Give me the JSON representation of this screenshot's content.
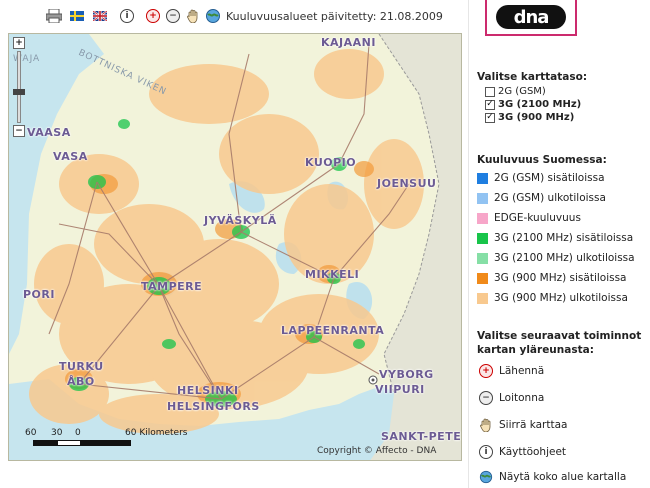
{
  "toolbar": {
    "updated_text": "Kuuluvuusalueet päivitetty: 21.08.2009",
    "icons": [
      "print-icon",
      "swedish-flag-icon",
      "uk-flag-icon",
      "info-icon",
      "zoom-in-icon",
      "zoom-out-icon",
      "pan-hand-icon",
      "full-extent-icon"
    ]
  },
  "map": {
    "cities": [
      "KAJAANI",
      "VAASA",
      "KUOPIO",
      "JOENSUU",
      "JYVÄSKYLÄ",
      "MIKKELI",
      "TAMPERE",
      "LAPPEENRANTA",
      "TURKU",
      "HELSINKI",
      "HELSINGFORS",
      "VYBORG",
      "VIIPURI",
      "SANKT-PETERBURG",
      "VASA",
      "ÅBO",
      "PORI"
    ],
    "seas": [
      "BOTTNISKA VIKEN",
      "WAJA"
    ],
    "scale": {
      "labels": [
        "60",
        "30",
        "0",
        "60 Kilometers"
      ]
    },
    "copyright": "Copyright © Affecto - DNA"
  },
  "panel": {
    "logo_text": "dna",
    "layer_title": "Valitse karttataso:",
    "layers": [
      {
        "label": "2G (GSM)",
        "checked": false
      },
      {
        "label": "3G (2100 MHz)",
        "checked": true
      },
      {
        "label": "3G (900 MHz)",
        "checked": true
      }
    ],
    "legend_title": "Kuuluvuus Suomessa:",
    "legend": [
      {
        "label": "2G (GSM) sisätiloissa",
        "color": "#1f7ee0"
      },
      {
        "label": "2G (GSM) ulkotiloissa",
        "color": "#92c3f2"
      },
      {
        "label": "EDGE-kuuluvuus",
        "color": "#f7a6c9"
      },
      {
        "label": "3G (2100 MHz) sisätiloissa",
        "color": "#18c44a"
      },
      {
        "label": "3G (2100 MHz) ulkotiloissa",
        "color": "#86dfa6"
      },
      {
        "label": "3G (900 MHz) sisätiloissa",
        "color": "#f08a1a"
      },
      {
        "label": "3G (900 MHz) ulkotiloissa",
        "color": "#f8c98f"
      }
    ],
    "tools_title_1": "Valitse seuraavat toiminnot",
    "tools_title_2": "kartan yläreunasta:",
    "tools": [
      {
        "label": "Lähennä",
        "icon": "zoom-in-icon"
      },
      {
        "label": "Loitonna",
        "icon": "zoom-out-icon"
      },
      {
        "label": "Siirrä karttaa",
        "icon": "pan-hand-icon"
      },
      {
        "label": "Käyttöohjeet",
        "icon": "info-icon"
      },
      {
        "label": "Näytä koko alue kartalla",
        "icon": "full-extent-icon"
      }
    ]
  }
}
